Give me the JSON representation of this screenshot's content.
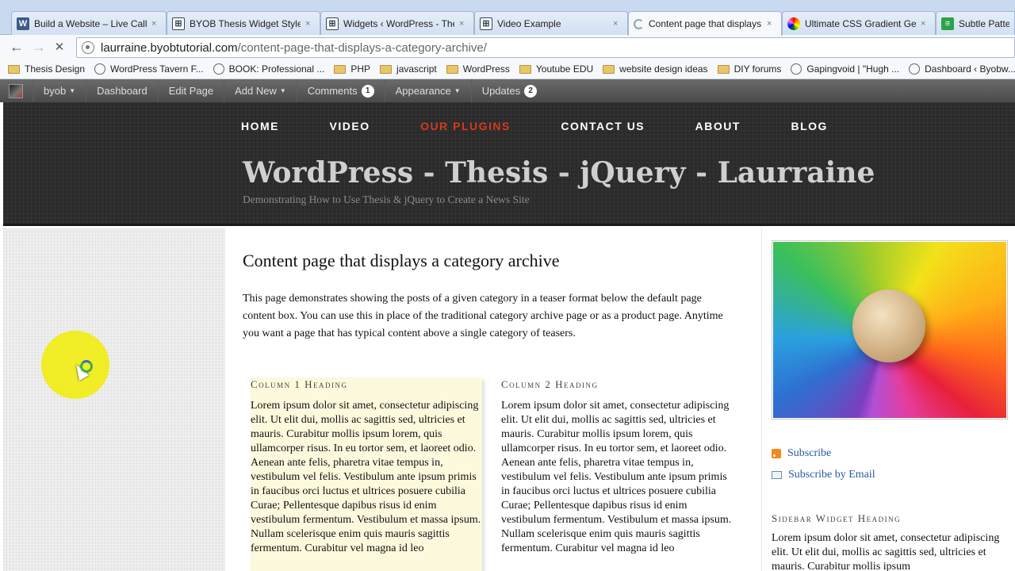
{
  "browser": {
    "tabs": [
      {
        "label": "Build a Website – Live Call I",
        "icon": "wordpress-icon",
        "active": false
      },
      {
        "label": "BYOB Thesis Widget Styles",
        "icon": "grid-icon",
        "active": false
      },
      {
        "label": "Widgets ‹ WordPress - Thes",
        "icon": "grid-icon",
        "active": false
      },
      {
        "label": "Video Example",
        "icon": "grid-icon",
        "active": false
      },
      {
        "label": "Content page that displays",
        "icon": "loading-spinner-icon",
        "active": true
      },
      {
        "label": "Ultimate CSS Gradient Gene",
        "icon": "rainbow-icon",
        "active": false
      },
      {
        "label": "Subtle Pattern",
        "icon": "green-icon",
        "active": false
      }
    ],
    "close_glyph": "×",
    "url_host": "laurraine.byobtutorial.com",
    "url_path": "/content-page-that-displays-a-category-archive/",
    "bookmarks": [
      {
        "label": "Thesis Design",
        "icon": "folder-icon"
      },
      {
        "label": "WordPress Tavern F...",
        "icon": "globe-icon"
      },
      {
        "label": "BOOK: Professional ...",
        "icon": "globe-icon"
      },
      {
        "label": "PHP",
        "icon": "folder-icon"
      },
      {
        "label": "javascript",
        "icon": "folder-icon"
      },
      {
        "label": "WordPress",
        "icon": "folder-icon"
      },
      {
        "label": "Youtube EDU",
        "icon": "folder-icon"
      },
      {
        "label": "website design ideas",
        "icon": "folder-icon"
      },
      {
        "label": "DIY forums",
        "icon": "folder-icon"
      },
      {
        "label": "Gapingvoid | \"Hugh ...",
        "icon": "globe-icon"
      },
      {
        "label": "Dashboard ‹ Byobw...",
        "icon": "globe-icon"
      }
    ]
  },
  "adminbar": {
    "site": "byob",
    "dashboard": "Dashboard",
    "edit_page": "Edit Page",
    "add_new": "Add New",
    "comments": "Comments",
    "comments_count": "1",
    "appearance": "Appearance",
    "updates": "Updates",
    "updates_count": "2"
  },
  "site": {
    "nav": [
      "HOME",
      "VIDEO",
      "OUR PLUGINS",
      "CONTACT US",
      "ABOUT",
      "BLOG"
    ],
    "title": "WordPress - Thesis - jQuery - Laurraine",
    "tagline": "Demonstrating How to Use Thesis & jQuery to Create a News Site",
    "accent_color": "#d63a1c"
  },
  "content": {
    "title": "Content page that displays a category archive",
    "intro": "This page demonstrates showing the posts of a given category in  a teaser format below the default page content box.  You can use this in place of the traditional category archive page or as a product page.  Anytime you want a page that has typical content above a single category of teasers.",
    "col1": {
      "heading": "Column 1 Heading",
      "text": "Lorem ipsum dolor sit amet, consectetur adipiscing elit. Ut elit dui, mollis ac sagittis sed, ultricies et mauris. Curabitur mollis ipsum lorem, quis ullamcorper risus. In eu tortor sem, et laoreet odio. Aenean ante felis, pharetra vitae tempus in, vestibulum vel felis. Vestibulum ante ipsum primis in faucibus orci luctus et ultrices posuere cubilia Curae; Pellentesque dapibus risus id enim vestibulum fermentum. Vestibulum et massa ipsum. Nullam scelerisque enim quis mauris sagittis fermentum. Curabitur vel magna id leo"
    },
    "col2": {
      "heading": "Column 2 Heading",
      "text": "Lorem ipsum dolor sit amet, consectetur adipiscing elit. Ut elit dui, mollis ac sagittis sed, ultricies et mauris. Curabitur mollis ipsum lorem, quis ullamcorper risus. In eu tortor sem, et laoreet odio. Aenean ante felis, pharetra vitae tempus in, vestibulum vel felis. Vestibulum ante ipsum primis in faucibus orci luctus et ultrices posuere cubilia Curae; Pellentesque dapibus risus id enim vestibulum fermentum. Vestibulum et massa ipsum. Nullam scelerisque enim quis mauris sagittis fermentum. Curabitur vel magna id leo"
    }
  },
  "sidebar": {
    "subscribe": "Subscribe",
    "subscribe_email": "Subscribe by Email",
    "widget_heading": "Sidebar Widget Heading",
    "widget_text": "Lorem ipsum dolor sit amet, consectetur adipiscing elit. Ut elit dui, mollis ac sagittis sed, ultricies et mauris. Curabitur mollis ipsum"
  }
}
